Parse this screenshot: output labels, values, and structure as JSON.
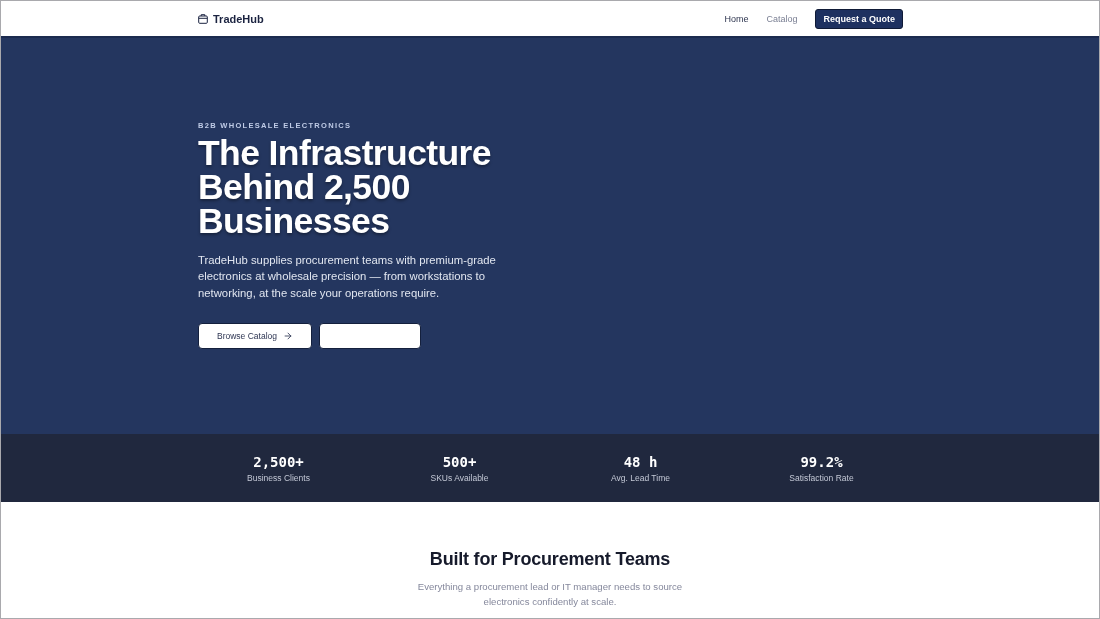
{
  "nav": {
    "brand": "TradeHub",
    "links": [
      {
        "label": "Home",
        "selected": true
      },
      {
        "label": "Catalog",
        "selected": false
      }
    ],
    "cta": "Request a Quote"
  },
  "hero": {
    "eyebrow": "B2B WHOLESALE ELECTRONICS",
    "title_lines": [
      "The Infrastructure",
      "Behind 2,500",
      "Businesses"
    ],
    "description": "TradeHub supplies procurement teams with premium-grade electronics at wholesale precision — from workstations to networking, at the scale your operations require.",
    "buttons": [
      {
        "kind": "primary",
        "label": "Browse Catalog"
      },
      {
        "kind": "plain"
      }
    ]
  },
  "stats": [
    {
      "value": "2,500+",
      "label": "Business Clients"
    },
    {
      "value": "500+",
      "label": "SKUs Available"
    },
    {
      "value": "48 h",
      "label": "Avg. Lead Time"
    },
    {
      "value": "99.2%",
      "label": "Satisfaction Rate"
    }
  ],
  "features_intro": {
    "title": "Built for Procurement Teams",
    "subtitle": "Everything a procurement lead or IT manager needs to source electronics confidently at scale."
  }
}
